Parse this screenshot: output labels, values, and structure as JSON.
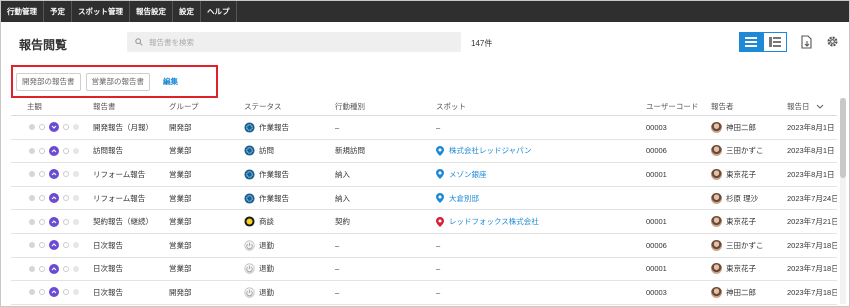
{
  "nav": [
    "行動管理",
    "予定",
    "スポット管理",
    "報告設定",
    "設定",
    "ヘルプ"
  ],
  "page": {
    "title": "報告閲覧"
  },
  "search": {
    "placeholder": "報告書を検索"
  },
  "result_count": "147件",
  "tabs": [
    "開発部の報告書",
    "営業部の報告書"
  ],
  "edit_label": "編集",
  "columns": [
    "主観",
    "報告書",
    "グループ",
    "ステータス",
    "行動種別",
    "スポット",
    "ユーザーコード",
    "報告者",
    "報告日"
  ],
  "rows": [
    {
      "variant": "v-down",
      "type": "開発報告（月報）",
      "group": "開発部",
      "status_icon": "work-report",
      "status": "作業報告",
      "kind": "–",
      "spot": "–",
      "spot_icon": "",
      "code": "00003",
      "user": "神田二郎",
      "date": "2023年8月1日"
    },
    {
      "variant": "v-up",
      "type": "訪問報告",
      "group": "営業部",
      "status_icon": "work-report",
      "status": "訪問",
      "kind": "新規訪問",
      "spot": "株式会社レッドジャパン",
      "spot_icon": "blue",
      "code": "00006",
      "user": "三田かずこ",
      "date": "2023年8月1日"
    },
    {
      "variant": "v-up",
      "type": "リフォーム報告",
      "group": "営業部",
      "status_icon": "work-report",
      "status": "作業報告",
      "kind": "納入",
      "spot": "メゾン銀座",
      "spot_icon": "blue",
      "code": "00001",
      "user": "東京花子",
      "date": "2023年8月1日"
    },
    {
      "variant": "v-up",
      "type": "リフォーム報告",
      "group": "営業部",
      "status_icon": "work-report",
      "status": "作業報告",
      "kind": "納入",
      "spot": "大倉別邸",
      "spot_icon": "blue",
      "code": "",
      "user": "杉原 理沙",
      "date": "2023年7月24日"
    },
    {
      "variant": "v-up",
      "type": "契約報告（継続）",
      "group": "営業部",
      "status_icon": "negotiation",
      "status": "商談",
      "kind": "契約",
      "spot": "レッドフォックス株式会社",
      "spot_icon": "red",
      "code": "00001",
      "user": "東京花子",
      "date": "2023年7月21日"
    },
    {
      "variant": "v-up",
      "type": "日次報告",
      "group": "営業部",
      "status_icon": "leave",
      "status": "退勤",
      "kind": "–",
      "spot": "–",
      "spot_icon": "",
      "code": "00006",
      "user": "三田かずこ",
      "date": "2023年7月18日"
    },
    {
      "variant": "v-up",
      "type": "日次報告",
      "group": "営業部",
      "status_icon": "leave",
      "status": "退勤",
      "kind": "–",
      "spot": "–",
      "spot_icon": "",
      "code": "00001",
      "user": "東京花子",
      "date": "2023年7月18日"
    },
    {
      "variant": "v-up",
      "type": "日次報告",
      "group": "開発部",
      "status_icon": "leave",
      "status": "退勤",
      "kind": "–",
      "spot": "–",
      "spot_icon": "",
      "code": "00003",
      "user": "神田二郎",
      "date": "2023年7月18日"
    }
  ],
  "colors": {
    "accent": "#1e8ad6",
    "highlight_border": "#e0202a",
    "purple": "#6a4bd1",
    "nav_bg": "#2f2f2f"
  }
}
